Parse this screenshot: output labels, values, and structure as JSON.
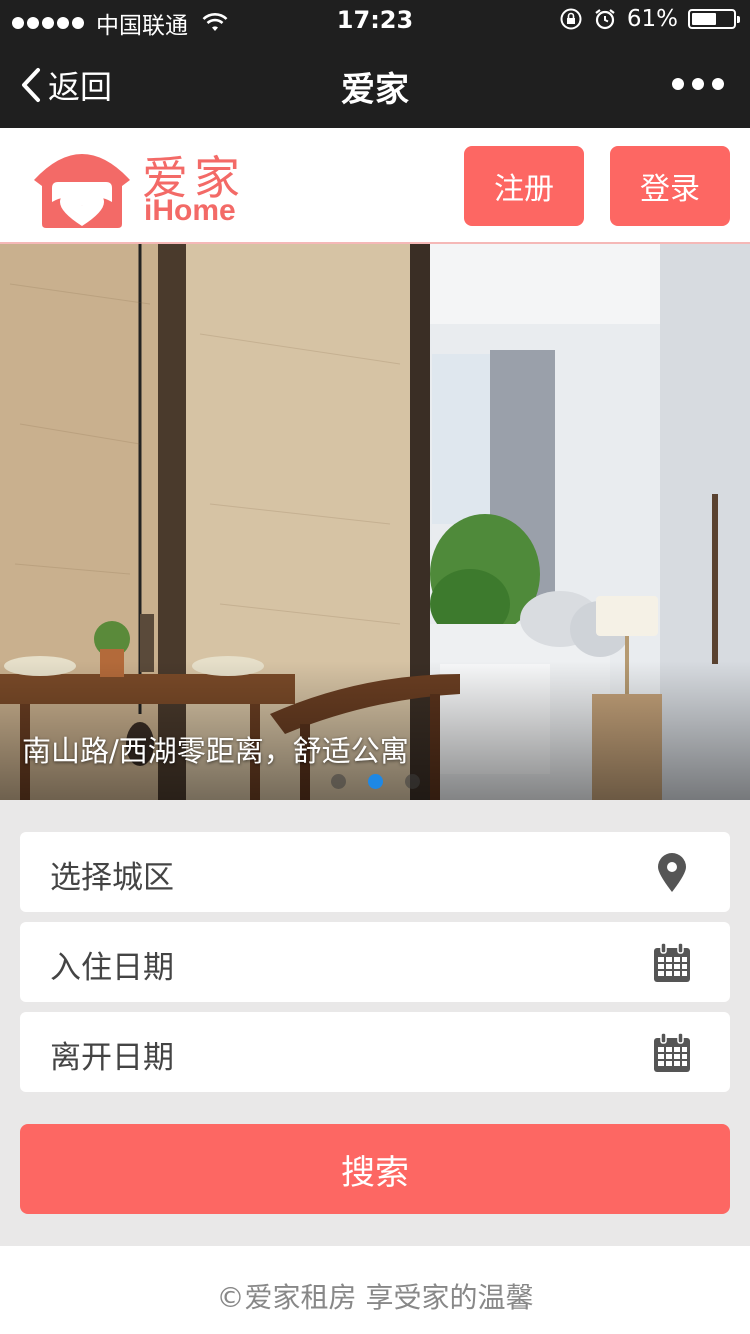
{
  "status_bar": {
    "carrier": "中国联通",
    "time": "17:23",
    "battery_percent": "61%",
    "battery_level": 0.61,
    "icons": [
      "signal-dots-icon",
      "wifi-icon",
      "rotation-lock-icon",
      "alarm-icon",
      "battery-icon"
    ]
  },
  "nav": {
    "back_label": "返回",
    "title": "爱家",
    "more_icon": "more-dots-icon"
  },
  "header": {
    "logo_zh": "爱家",
    "logo_en": "iHome",
    "register_label": "注册",
    "login_label": "登录"
  },
  "banner": {
    "caption": "南山路/西湖零距离，舒适公寓",
    "slide_count": 3,
    "active_slide": 2
  },
  "form": {
    "area_label": "选择城区",
    "checkin_label": "入住日期",
    "checkout_label": "离开日期",
    "search_label": "搜索"
  },
  "footer": {
    "text": "©爱家租房  享受家的温馨"
  },
  "colors": {
    "accent": "#fd6763",
    "bar": "#1f1f1f",
    "background": "#e9e8e8",
    "active_dot": "#1e88e5"
  }
}
